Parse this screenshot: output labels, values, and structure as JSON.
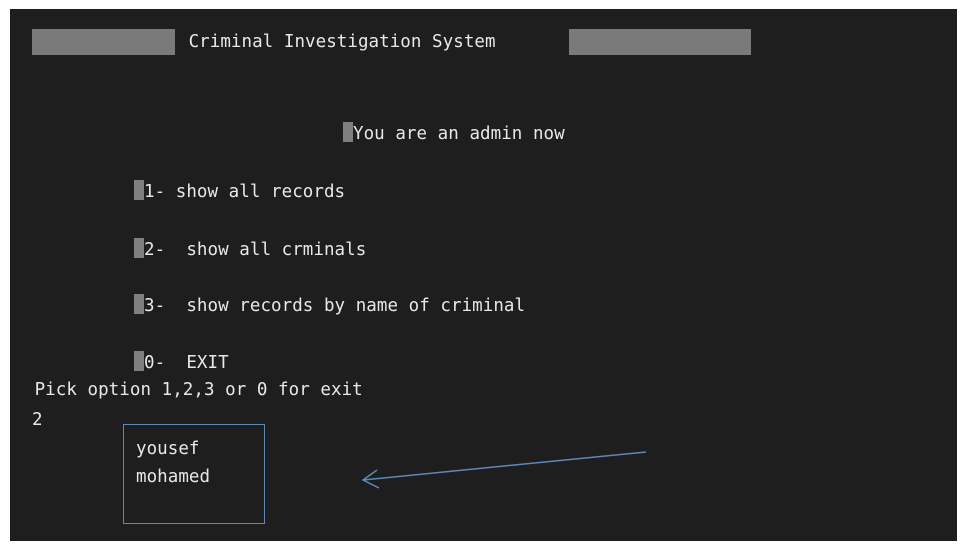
{
  "header": {
    "title": " Criminal Investigation System "
  },
  "admin_notice": "You are an admin now",
  "menu": {
    "items": [
      {
        "label": "1- show all records"
      },
      {
        "label": "2-  show all crminals"
      },
      {
        "label": "3-  show records by name of criminal"
      },
      {
        "label": "0-  EXIT"
      }
    ]
  },
  "prompt": " Pick option 1,2,3 or 0 for exit",
  "user_input": "2",
  "results": {
    "criminals": [
      "yousef",
      "mohamed"
    ]
  },
  "annotation": {
    "color": "#5f88b8",
    "icon": "arrow-left-icon"
  },
  "colors": {
    "background": "#1e1e1e",
    "text": "#e8e8e8"
  }
}
